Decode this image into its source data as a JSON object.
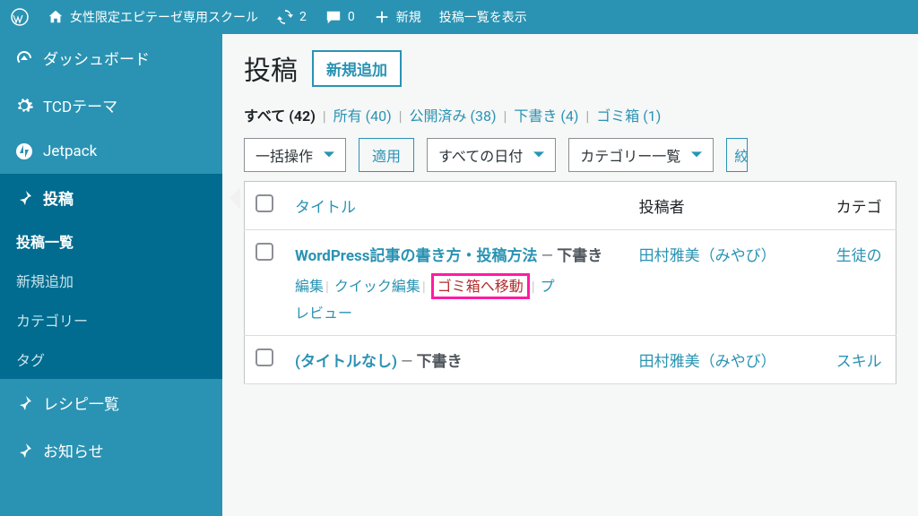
{
  "admin_bar": {
    "site_name": "女性限定エピテーゼ専用スクール",
    "updates_count": "2",
    "comments_count": "0",
    "new_label": "新規",
    "view_posts_label": "投稿一覧を表示"
  },
  "sidebar": {
    "items": [
      {
        "label": "ダッシュボード"
      },
      {
        "label": "TCDテーマ"
      },
      {
        "label": "Jetpack"
      },
      {
        "label": "投稿"
      },
      {
        "label": "レシピ一覧"
      },
      {
        "label": "お知らせ"
      }
    ],
    "submenu": [
      {
        "label": "投稿一覧",
        "current": true
      },
      {
        "label": "新規追加"
      },
      {
        "label": "カテゴリー"
      },
      {
        "label": "タグ"
      }
    ]
  },
  "page": {
    "title": "投稿",
    "add_new": "新規追加"
  },
  "filters": {
    "all_label": "すべて",
    "all_count": "(42)",
    "mine_label": "所有",
    "mine_count": "(40)",
    "published_label": "公開済み",
    "published_count": "(38)",
    "draft_label": "下書き",
    "draft_count": "(4)",
    "trash_label": "ゴミ箱",
    "trash_count": "(1)"
  },
  "tablenav": {
    "bulk_action": "一括操作",
    "apply": "適用",
    "all_dates": "すべての日付",
    "category_list": "カテゴリー一覧"
  },
  "columns": {
    "title": "タイトル",
    "author": "投稿者",
    "categories": "カテゴ"
  },
  "posts": [
    {
      "title": "WordPress記事の書き方・投稿方法",
      "dash": " — ",
      "state": "下書き",
      "author": "田村雅美（みやび）",
      "category": "生徒の",
      "edit": "編集",
      "quick_edit": "クイック編集",
      "trash": "ゴミ箱へ移動",
      "preview_prefix": "プ",
      "preview_rest": "レビュー"
    },
    {
      "title": "(タイトルなし)",
      "dash": " — ",
      "state": "下書き",
      "author": "田村雅美（みやび）",
      "category": "スキル"
    }
  ]
}
